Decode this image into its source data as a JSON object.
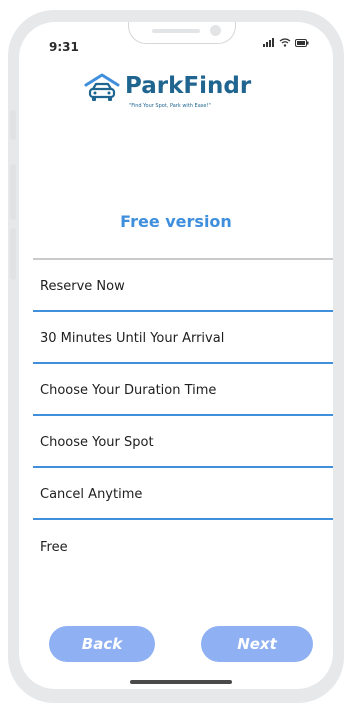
{
  "status_bar": {
    "time": "9:31"
  },
  "brand": {
    "name": "ParkFindr",
    "tagline": "\"Find Your Spot, Park with Ease!\"",
    "color": "#1f6590"
  },
  "plan": {
    "title": "Free version",
    "accent": "#3f8fdd"
  },
  "features": [
    {
      "label": "Reserve Now"
    },
    {
      "label": "30 Minutes Until Your Arrival"
    },
    {
      "label": "Choose Your Duration Time"
    },
    {
      "label": "Choose Your Spot"
    },
    {
      "label": "Cancel Anytime"
    },
    {
      "label": "Free"
    }
  ],
  "nav": {
    "back_label": "Back",
    "next_label": "Next",
    "button_color": "#8fb0f2"
  },
  "icons": [
    "signal-icon",
    "wifi-icon",
    "battery-icon",
    "car-logo-icon"
  ]
}
